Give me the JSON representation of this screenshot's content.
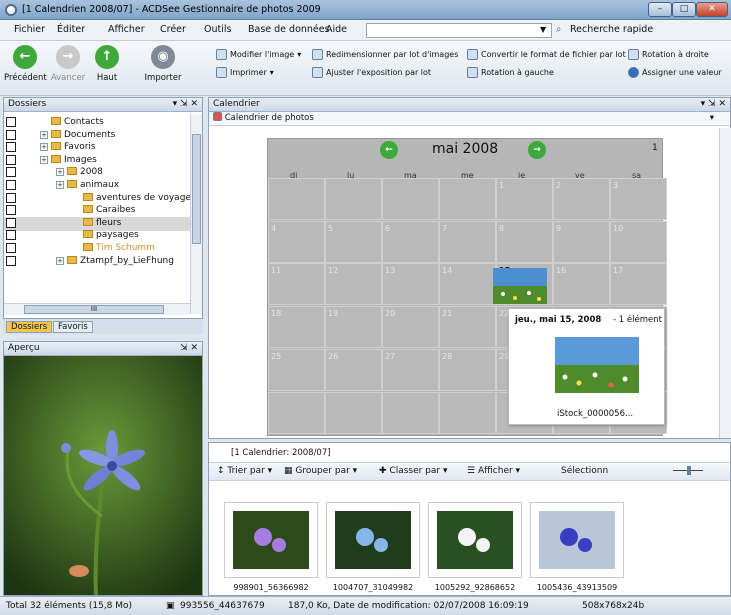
{
  "window": {
    "title": "[1 Calendrien 2008/07] - ACDSee Gestionnaire de photos 2009"
  },
  "menu": [
    "Fichier",
    "Éditer",
    "Afficher",
    "Créer",
    "Outils",
    "Base de données",
    "Aide"
  ],
  "menu_search": {
    "label": "Recherche rapide"
  },
  "toolbar": {
    "precedent": "Précédent",
    "avancer": "Avancer",
    "haut": "Haut",
    "importer": "Importer",
    "modifier": "Modifier l'image",
    "imprimer": "Imprimer",
    "redim": "Redimensionner par lot d'images",
    "ajuster": "Ajuster l'exposition par lot",
    "convertir": "Convertir le format de fichier par lot",
    "rotation_gauche": "Rotation à gauche",
    "rotation_droite": "Rotation à droite",
    "assigner": "Assigner une valeur"
  },
  "folders": {
    "title": "Dossiers",
    "items": [
      "Contacts",
      "Documents",
      "Favoris",
      "Images",
      "2008",
      "animaux",
      "aventures de voyage",
      "Caraibes",
      "fleurs",
      "paysages",
      "Tim Schumm",
      "Ztampf_by_LieFhung"
    ],
    "tabs": [
      "Dossiers",
      "Favoris"
    ],
    "scroll_label": "III"
  },
  "preview": {
    "title": "Aperçu"
  },
  "calendar": {
    "panel_title": "Calendrier",
    "subtitle": "Calendrier de photos",
    "month": "mai 2008",
    "week_count": "1",
    "days": [
      "di",
      "lu",
      "ma",
      "me",
      "je",
      "ve",
      "sa"
    ],
    "rows": [
      [
        "",
        "",
        "",
        "",
        "1",
        "2",
        "3"
      ],
      [
        "4",
        "5",
        "6",
        "7",
        "8",
        "9",
        "10"
      ],
      [
        "11",
        "12",
        "13",
        "14",
        "15",
        "16",
        "17"
      ],
      [
        "18",
        "19",
        "20",
        "21",
        "22",
        "",
        ""
      ],
      [
        "25",
        "26",
        "27",
        "28",
        "29",
        "",
        ""
      ],
      [
        "",
        "",
        "",
        "",
        "",
        "",
        ""
      ]
    ],
    "popup": {
      "date": "jeu., mai 15, 2008",
      "count": "- 1 élément",
      "file": "iStock_0000056..."
    }
  },
  "thumbs": {
    "header": "[1 Calendrier: 2008/07]",
    "trier": "Trier par",
    "grouper": "Grouper par",
    "classer": "Classer par",
    "afficher": "Afficher",
    "selection": "Sélectionn",
    "items": [
      "998901_56366982",
      "1004707_31049982",
      "1005292_92868652",
      "1005436_43913509"
    ]
  },
  "status": {
    "total": "Total 32 éléments (15,8 Mo)",
    "file": "993556_44637679",
    "info": "187,0 Ko, Date de modification: 02/07/2008 16:09:19",
    "dims": "508x768x24b"
  }
}
